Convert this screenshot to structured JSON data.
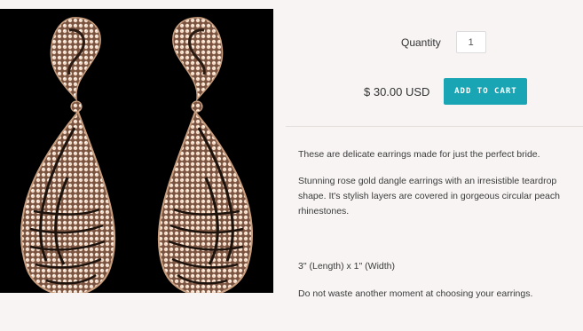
{
  "product": {
    "image_alt": "rose gold teardrop dangle earrings",
    "quantity_label": "Quantity",
    "quantity_value": "1",
    "price": "$ 30.00 USD",
    "add_to_cart_label": "ADD TO CART",
    "accent_color": "#1aa5b4",
    "description": [
      "These are delicate earrings made for just the perfect bride.",
      "Stunning rose gold dangle earrings with an irresistible teardrop shape. It's stylish layers are covered in gorgeous circular peach rhinestones.",
      "3\" (Length) x 1\" (Width)",
      "Do not waste another moment at choosing your earrings."
    ]
  }
}
